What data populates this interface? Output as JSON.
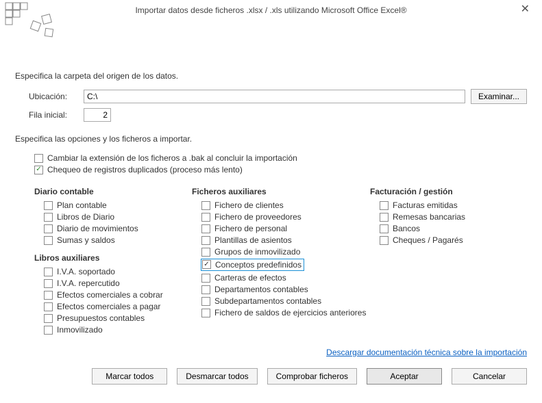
{
  "title": "Importar datos desde ficheros .xlsx / .xls utilizando Microsoft Office Excel®",
  "sectionSource": "Especifica la carpeta del origen de los datos.",
  "locationLabel": "Ubicación:",
  "locationValue": "C:\\",
  "browseBtn": "Examinar...",
  "rowLabel": "Fila inicial:",
  "rowValue": "2",
  "sectionOptions": "Especifica las opciones y los ficheros a importar.",
  "optBak": {
    "label": "Cambiar la extensión de los ficheros a .bak al concluir la importación",
    "checked": false
  },
  "optDup": {
    "label": "Chequeo de registros duplicados (proceso más lento)",
    "checked": true
  },
  "groups": {
    "diario": {
      "heading": "Diario contable",
      "items": [
        {
          "label": "Plan contable",
          "checked": false
        },
        {
          "label": "Libros de Diario",
          "checked": false
        },
        {
          "label": "Diario de movimientos",
          "checked": false
        },
        {
          "label": "Sumas y saldos",
          "checked": false
        }
      ]
    },
    "libros": {
      "heading": "Libros auxiliares",
      "items": [
        {
          "label": "I.V.A. soportado",
          "checked": false
        },
        {
          "label": "I.V.A. repercutido",
          "checked": false
        },
        {
          "label": "Efectos comerciales a cobrar",
          "checked": false
        },
        {
          "label": "Efectos comerciales a pagar",
          "checked": false
        },
        {
          "label": "Presupuestos contables",
          "checked": false
        },
        {
          "label": "Inmovilizado",
          "checked": false
        }
      ]
    },
    "ficheros": {
      "heading": "Ficheros auxiliares",
      "items": [
        {
          "label": "Fichero de clientes",
          "checked": false
        },
        {
          "label": "Fichero de proveedores",
          "checked": false
        },
        {
          "label": "Fichero de personal",
          "checked": false
        },
        {
          "label": "Plantillas de asientos",
          "checked": false
        },
        {
          "label": "Grupos de inmovilizado",
          "checked": false
        },
        {
          "label": "Conceptos predefinidos",
          "checked": true,
          "highlight": true
        },
        {
          "label": "Carteras de efectos",
          "checked": false
        },
        {
          "label": "Departamentos contables",
          "checked": false
        },
        {
          "label": "Subdepartamentos contables",
          "checked": false
        },
        {
          "label": "Fichero de saldos de ejercicios anteriores",
          "checked": false
        }
      ]
    },
    "facturacion": {
      "heading": "Facturación / gestión",
      "items": [
        {
          "label": "Facturas emitidas",
          "checked": false
        },
        {
          "label": "Remesas bancarias",
          "checked": false
        },
        {
          "label": "Bancos",
          "checked": false
        },
        {
          "label": "Cheques / Pagarés",
          "checked": false
        }
      ]
    }
  },
  "docLink": "Descargar documentación técnica sobre la importación",
  "buttons": {
    "markAll": "Marcar todos",
    "unmarkAll": "Desmarcar todos",
    "check": "Comprobar ficheros",
    "accept": "Aceptar",
    "cancel": "Cancelar"
  }
}
